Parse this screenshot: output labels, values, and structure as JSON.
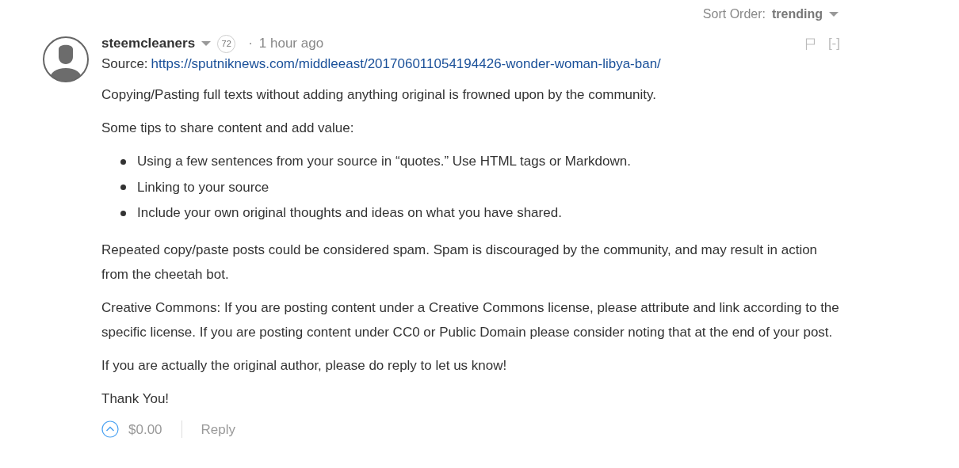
{
  "sort_order": {
    "label": "Sort Order:",
    "value": "trending"
  },
  "comment": {
    "author": "steemcleaners",
    "reputation": "72",
    "separator": "·",
    "time": "1 hour ago",
    "collapse": "[-]",
    "body": [
      {
        "kind": "source",
        "label": "Source:",
        "link": "https://sputniknews.com/middleeast/201706011054194426-wonder-woman-libya-ban/"
      },
      {
        "kind": "paragraph",
        "text": "Copying/Pasting full texts without adding anything original is frowned upon by the community."
      },
      {
        "kind": "paragraph",
        "text": "Some tips to share content and add value:"
      },
      {
        "kind": "list",
        "items": [
          "Using a few sentences from your source in “quotes.” Use HTML tags or Markdown.",
          "Linking to your source",
          "Include your own original thoughts and ideas on what you have shared."
        ]
      },
      {
        "kind": "paragraph",
        "text": "Repeated copy/paste posts could be considered spam. Spam is discouraged by the community, and may result in action from the cheetah bot."
      },
      {
        "kind": "paragraph",
        "text": "Creative Commons: If you are posting content under a Creative Commons license, please attribute and link according to the specific license. If you are posting content under CC0 or Public Domain please consider noting that at the end of your post."
      },
      {
        "kind": "paragraph",
        "text": "If you are actually the original author, please do reply to let us know!"
      },
      {
        "kind": "paragraph",
        "text": "Thank You!"
      }
    ],
    "payout": "$0.00",
    "reply": "Reply"
  }
}
